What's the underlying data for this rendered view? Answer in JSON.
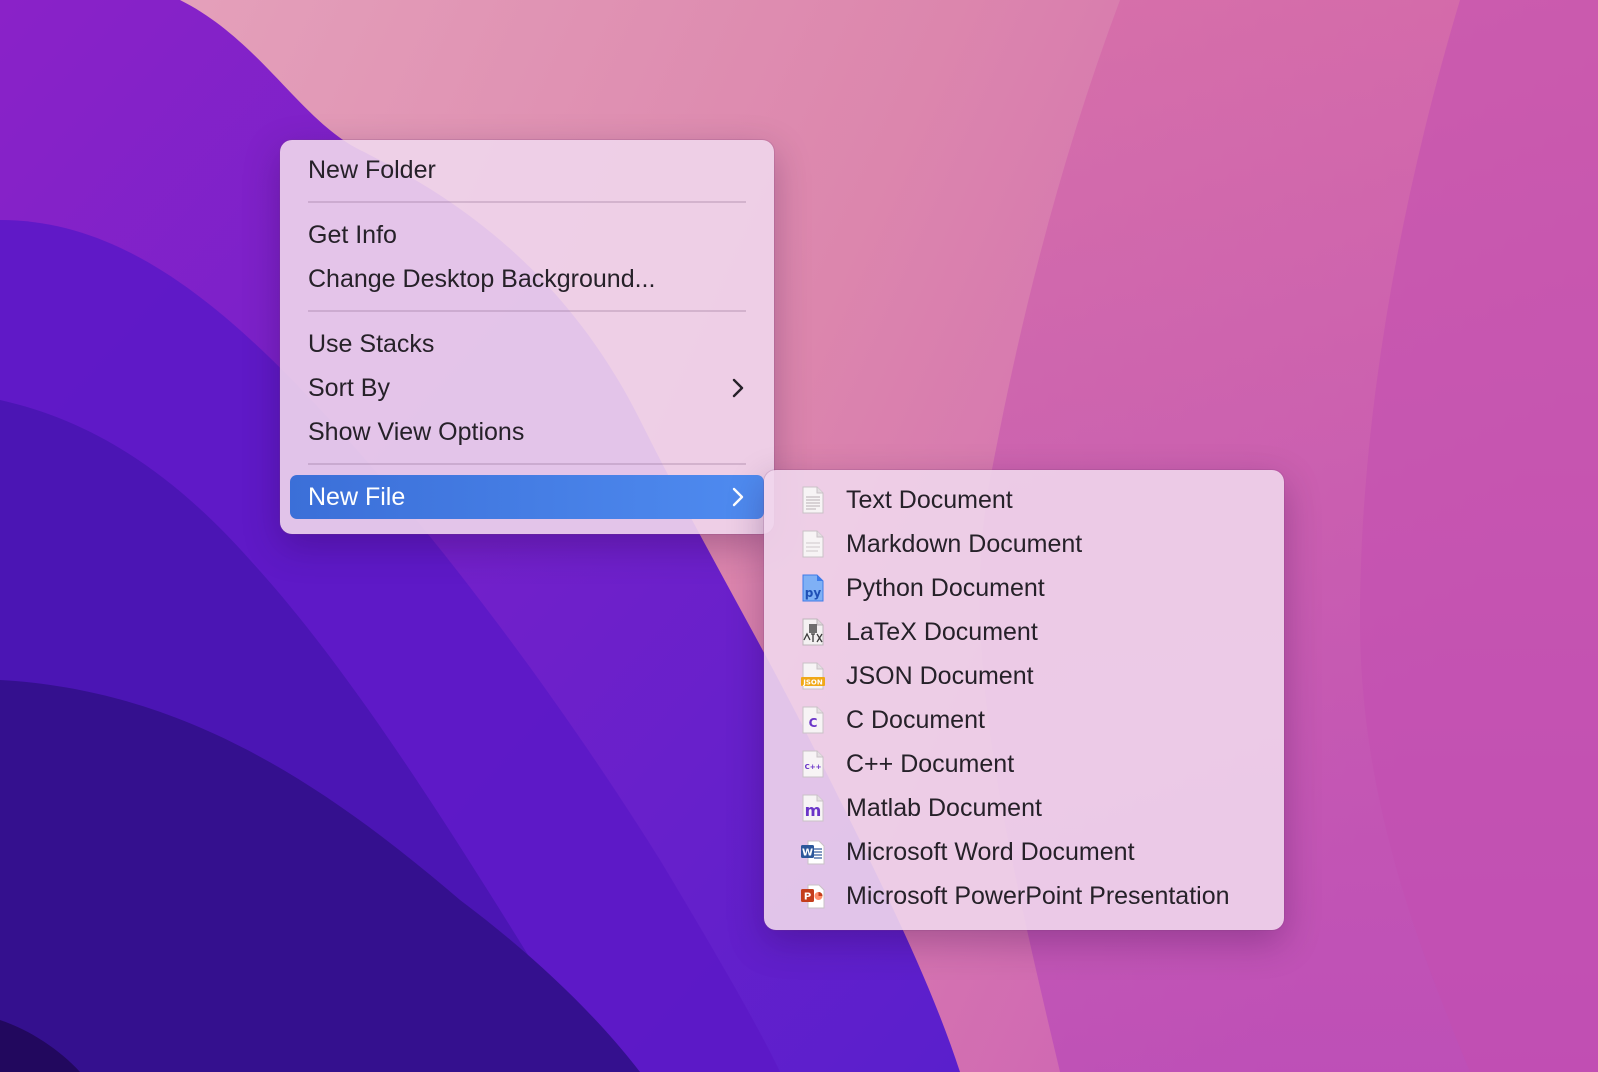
{
  "main_menu": {
    "items": [
      {
        "label": "New Folder"
      },
      {
        "label": "Get Info"
      },
      {
        "label": "Change Desktop Background..."
      },
      {
        "label": "Use Stacks"
      },
      {
        "label": "Sort By",
        "has_submenu": true
      },
      {
        "label": "Show View Options"
      },
      {
        "label": "New File",
        "has_submenu": true,
        "highlighted": true
      }
    ]
  },
  "new_file_submenu": {
    "items": [
      {
        "label": "Text Document",
        "icon": "text-document-icon"
      },
      {
        "label": "Markdown Document",
        "icon": "markdown-document-icon"
      },
      {
        "label": "Python Document",
        "icon": "python-document-icon",
        "icon_text": "py"
      },
      {
        "label": "LaTeX Document",
        "icon": "latex-document-icon"
      },
      {
        "label": "JSON Document",
        "icon": "json-document-icon",
        "icon_text": "JSON"
      },
      {
        "label": "C Document",
        "icon": "c-document-icon",
        "icon_text": "C"
      },
      {
        "label": "C++ Document",
        "icon": "cpp-document-icon",
        "icon_text": "C++"
      },
      {
        "label": "Matlab Document",
        "icon": "matlab-document-icon",
        "icon_text": "m"
      },
      {
        "label": "Microsoft Word Document",
        "icon": "word-document-icon",
        "icon_text": "W"
      },
      {
        "label": "Microsoft PowerPoint Presentation",
        "icon": "powerpoint-document-icon",
        "icon_text": "P"
      }
    ]
  },
  "colors": {
    "highlight": "#3b6fd8",
    "python": "#3d7be8",
    "json": "#f0a817",
    "c_purple": "#6b35c8",
    "word": "#2b579a",
    "powerpoint": "#c43e1c"
  }
}
